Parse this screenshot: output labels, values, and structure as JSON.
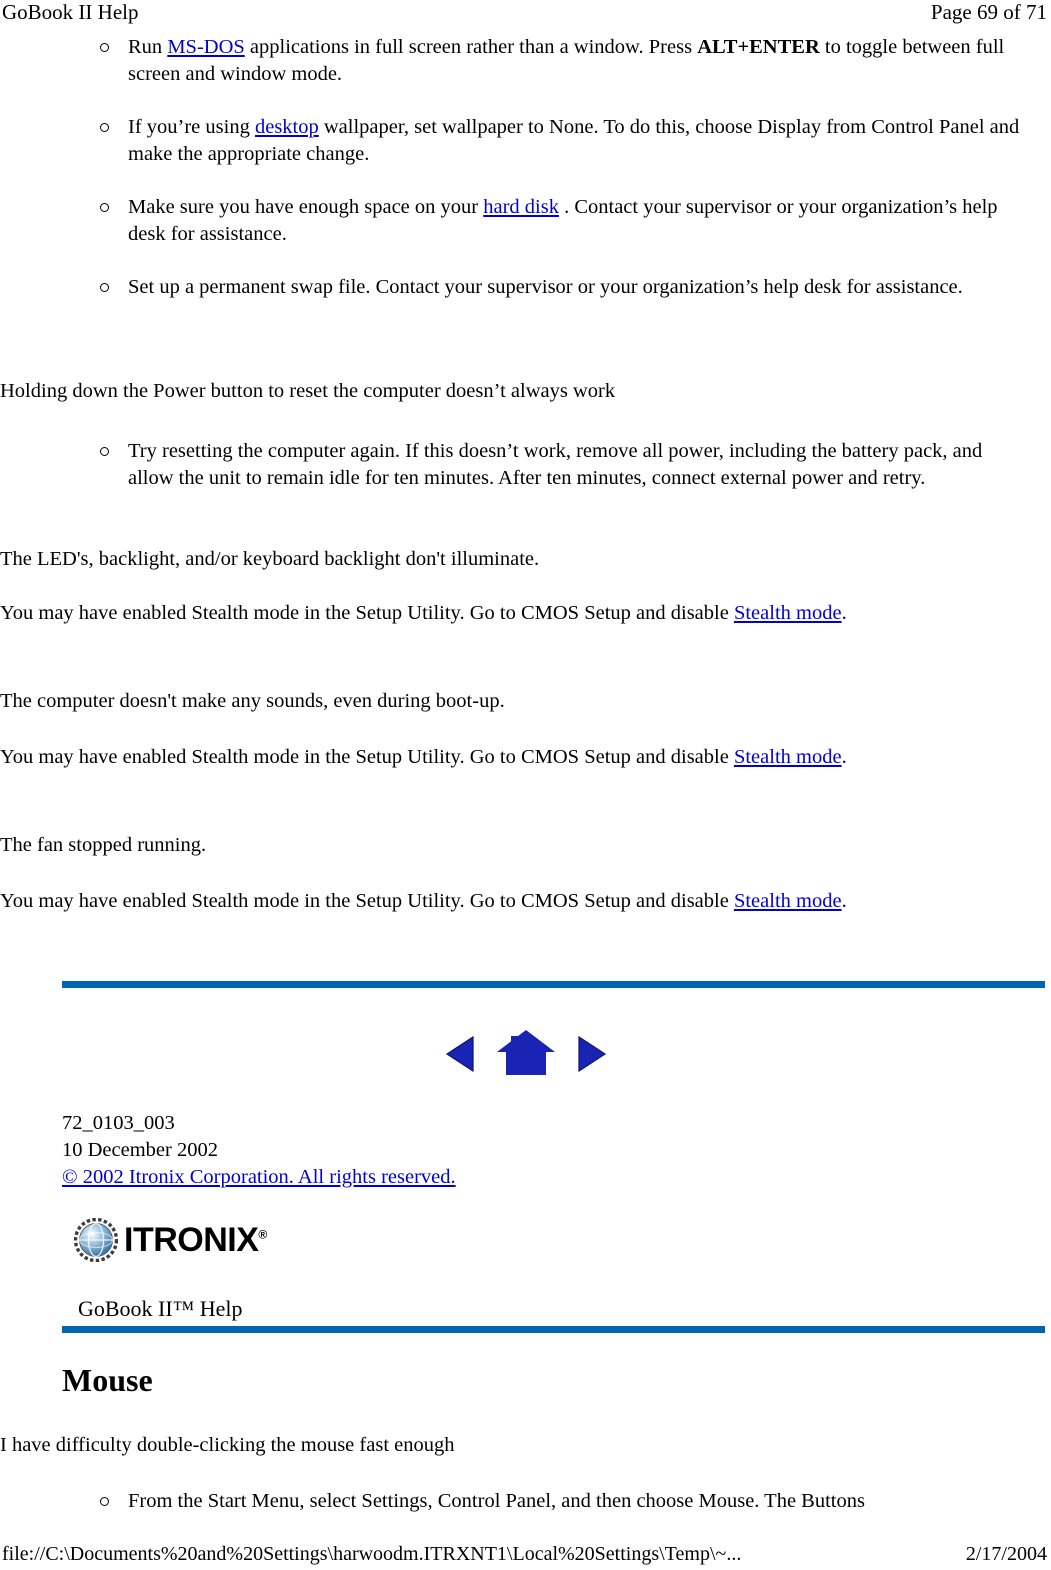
{
  "header": {
    "title": "GoBook II Help",
    "page_label": "Page 69 of 71"
  },
  "colors": {
    "rule_blue": "#0066B0",
    "link_blue": "#0000D8",
    "nav_icon_blue": "#1010C8"
  },
  "body": {
    "bullets_group_1": [
      {
        "pre": "Run ",
        "link": "MS-DOS",
        "mid": " applications in full screen rather than a window. Press ",
        "bold": "ALT+ENTER",
        "post": " to toggle between full screen and window mode."
      },
      {
        "pre": "If you’re using ",
        "link": "desktop",
        "mid": "",
        "bold": "",
        "post": " wallpaper, set wallpaper to None. To do this, choose Display from Control Panel and make the appropriate change."
      },
      {
        "pre": "Make sure you have enough space on your ",
        "link": "hard disk",
        "mid": "",
        "bold": "",
        "post": " . Contact your supervisor or your organization’s help desk for assistance."
      },
      {
        "pre": "Set up a permanent swap file. Contact your supervisor or your organization’s help desk for assistance.",
        "link": "",
        "mid": "",
        "bold": "",
        "post": ""
      }
    ],
    "heading_power": "Holding down the Power button to reset the computer doesn’t always work",
    "bullet_reset": "Try resetting the computer again. If this doesn’t work, remove all power, including the battery pack, and allow the unit to remain idle for ten minutes. After ten minutes, connect external power and retry.",
    "q_led": "The LED's, backlight, and/or keyboard backlight don't illuminate.",
    "a_led_pre": "You may have enabled Stealth mode in the Setup Utility.  Go to CMOS Setup and disable ",
    "a_led_link": "Stealth mode",
    "a_led_post": ".",
    "q_sound": "The computer doesn't make any sounds, even during boot-up.",
    "a_sound_pre": "You may have enabled  Stealth mode in the Setup Utility.  Go to CMOS Setup and disable ",
    "a_sound_link": "Stealth mode",
    "a_sound_post": ".",
    "q_fan": "The fan stopped running.",
    "a_fan_pre": "You may have enabled Stealth mode in the Setup Utility.  Go to CMOS Setup and disable ",
    "a_fan_link": "Stealth mode",
    "a_fan_post": "."
  },
  "nav": {
    "back": "back-arrow",
    "home": "home",
    "forward": "forward-arrow"
  },
  "docinfo": {
    "doc_number": "72_0103_003",
    "date": "10 December 2002",
    "copyright": "© 2002 Itronix Corporation.  All rights reserved."
  },
  "logo": {
    "icon": "globe-icon",
    "wordmark": "ITRONIX",
    "trademark_symbol": "®"
  },
  "subtitle": "GoBook II™ Help",
  "section": {
    "title": "Mouse",
    "question": "I have difficulty double-clicking the mouse fast enough",
    "bullet": "From the Start Menu, select Settings, Control Panel, and then choose Mouse.  The Buttons"
  },
  "footer": {
    "path": "file://C:\\Documents%20and%20Settings\\harwoodm.ITRXNT1\\Local%20Settings\\Temp\\~...",
    "date": "2/17/2004"
  }
}
